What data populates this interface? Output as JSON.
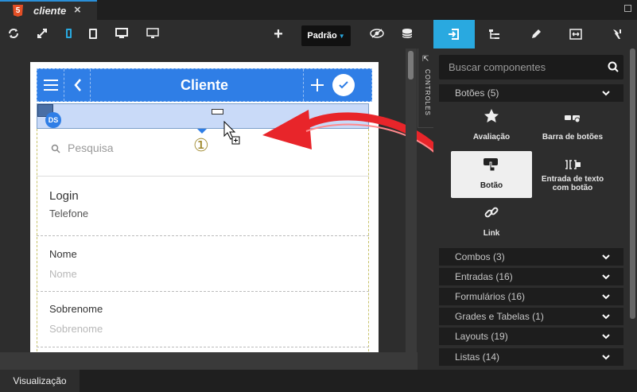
{
  "window": {
    "tab_title": "cliente",
    "close_symbol": "×"
  },
  "toolbar": {
    "add_symbol": "+",
    "theme_select": "Padrão"
  },
  "side_label": "CONTROLES",
  "phone": {
    "appbar_title": "Cliente",
    "drop_badge": "DS",
    "step_number": "①",
    "search_placeholder": "Pesquisa",
    "list_title": "Login",
    "list_subtitle": "Telefone",
    "fields": [
      {
        "label": "Nome",
        "placeholder": "Nome"
      },
      {
        "label": "Sobrenome",
        "placeholder": "Sobrenome"
      }
    ]
  },
  "components": {
    "search_placeholder": "Buscar componentes",
    "expanded_category": "Botões (5)",
    "items": [
      {
        "label": "Avaliação",
        "icon": "star-icon"
      },
      {
        "label": "Barra de botões",
        "icon": "button-bar-icon"
      },
      {
        "label": "Botão",
        "icon": "button-touch-icon",
        "selected": true
      },
      {
        "label": "Entrada de texto com botão",
        "icon": "text-input-button-icon"
      },
      {
        "label": "Link",
        "icon": "link-icon"
      }
    ],
    "categories": [
      "Combos (3)",
      "Entradas (16)",
      "Formulários (16)",
      "Grades e Tabelas (1)",
      "Layouts (19)",
      "Listas (14)"
    ]
  },
  "bottom_tab": "Visualização",
  "colors": {
    "accent": "#29a9e0",
    "appbar": "#2f7ee6",
    "drop_highlight": "#c9daf8",
    "arrow": "#e8252a"
  }
}
